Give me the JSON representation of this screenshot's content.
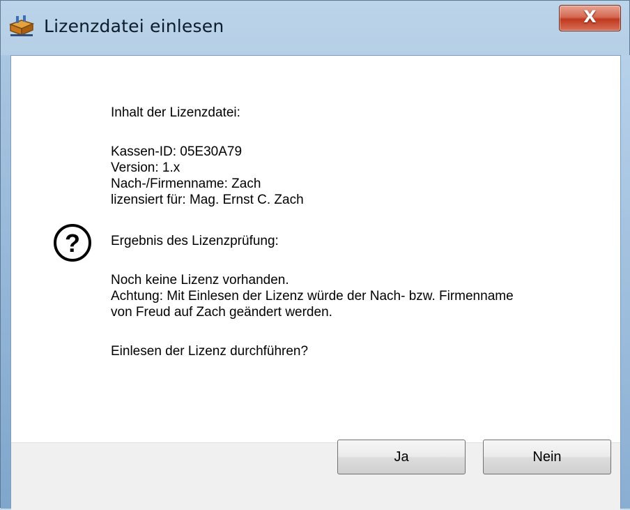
{
  "window": {
    "title": "Lizenzdatei einlesen",
    "close_glyph": "X",
    "app_icon": "license-file-icon"
  },
  "message": {
    "icon": "question-icon",
    "line1": "Inhalt der Lizenzdatei:",
    "details": [
      "Kassen-ID: 05E30A79",
      "Version: 1.x",
      "Nach-/Firmenname: Zach",
      "lizensiert für: Mag. Ernst C. Zach"
    ],
    "result_label": "Ergebnis des Lizenzprüfung:",
    "result_lines": [
      "Noch keine Lizenz vorhanden.",
      "Achtung: Mit Einlesen der Lizenz würde der Nach- bzw. Firmenname",
      "von Freud auf Zach geändert werden."
    ],
    "question": "Einlesen der Lizenz durchführen?"
  },
  "buttons": {
    "yes": "Ja",
    "no": "Nein"
  }
}
